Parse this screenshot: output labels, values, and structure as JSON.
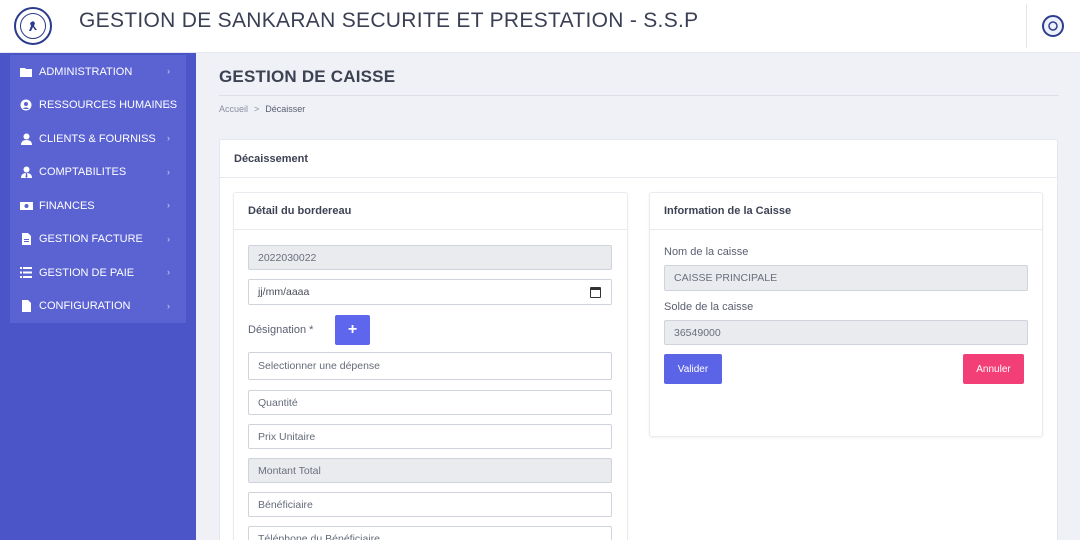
{
  "header": {
    "title": "GESTION DE SANKARAN SECURITE ET PRESTATION - S.S.P"
  },
  "sidebar": {
    "items": [
      {
        "label": "ADMINISTRATION",
        "icon": "folder-icon"
      },
      {
        "label": "RESSOURCES HUMAINES",
        "icon": "user-circle-icon"
      },
      {
        "label": "CLIENTS & FOURNISS",
        "icon": "user-icon"
      },
      {
        "label": "COMPTABILITES",
        "icon": "user-tie-icon"
      },
      {
        "label": "FINANCES",
        "icon": "money-icon"
      },
      {
        "label": "GESTION FACTURE",
        "icon": "file-icon"
      },
      {
        "label": "GESTION DE PAIE",
        "icon": "list-icon"
      },
      {
        "label": "CONFIGURATION",
        "icon": "document-icon"
      }
    ]
  },
  "page": {
    "title": "GESTION DE CAISSE",
    "breadcrumb": {
      "home": "Accueil",
      "separator": ">",
      "current": "Décaisser"
    },
    "card_title": "Décaissement"
  },
  "left_card": {
    "title": "Détail du bordereau",
    "numero": "2022030022",
    "date_placeholder": "jj/mm/aaaa",
    "designation_label": "Désignation *",
    "add_button": "+",
    "depense_placeholder": "Selectionner une dépense",
    "quantite_placeholder": "Quantité",
    "prix_placeholder": "Prix Unitaire",
    "montant_placeholder": "Montant Total",
    "beneficiaire_placeholder": "Bénéficiaire",
    "telephone_placeholder": "Téléphone du Bénéficiaire"
  },
  "right_card": {
    "title": "Information de la Caisse",
    "nom_label": "Nom de la caisse",
    "nom_value": "CAISSE PRINCIPALE",
    "solde_label": "Solde de la caisse",
    "solde_value": "36549000",
    "valider": "Valider",
    "annuler": "Annuler"
  },
  "colors": {
    "sidebar": "#4c55c7",
    "menu": "#5b63d3",
    "primary": "#5b63e6",
    "danger": "#f23f78"
  }
}
